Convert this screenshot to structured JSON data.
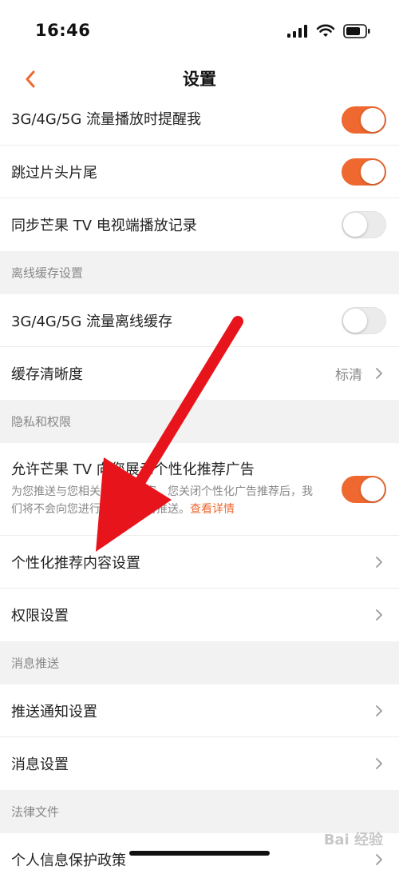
{
  "status": {
    "time": "16:46"
  },
  "nav": {
    "title": "设置"
  },
  "rows_top": [
    {
      "label": "3G/4G/5G 流量播放时提醒我",
      "toggle": true
    },
    {
      "label": "跳过片头片尾",
      "toggle": true
    },
    {
      "label": "同步芒果 TV 电视端播放记录",
      "toggle": false
    }
  ],
  "sections": {
    "offline": "离线缓存设置",
    "privacy": "隐私和权限",
    "push": "消息推送",
    "legal": "法律文件"
  },
  "offline": {
    "cellular_label": "3G/4G/5G 流量离线缓存",
    "cellular_toggle": false,
    "quality_label": "缓存清晰度",
    "quality_value": "标清"
  },
  "privacy": {
    "ad_title": "允许芒果 TV 向您展示个性化推荐广告",
    "ad_desc": "为您推送与您相关的广告内容，您关闭个性化广告推荐后，我们将不会向您进行精准的广告推送。",
    "ad_link": "查看详情",
    "ad_toggle": true,
    "recommend_label": "个性化推荐内容设置",
    "permission_label": "权限设置"
  },
  "push": {
    "notify_label": "推送通知设置",
    "message_label": "消息设置"
  },
  "legal": {
    "privacy_policy_label": "个人信息保护政策"
  },
  "watermark": "Bai 经验",
  "colors": {
    "accent": "#ee6830",
    "arrow": "#e8141c"
  }
}
